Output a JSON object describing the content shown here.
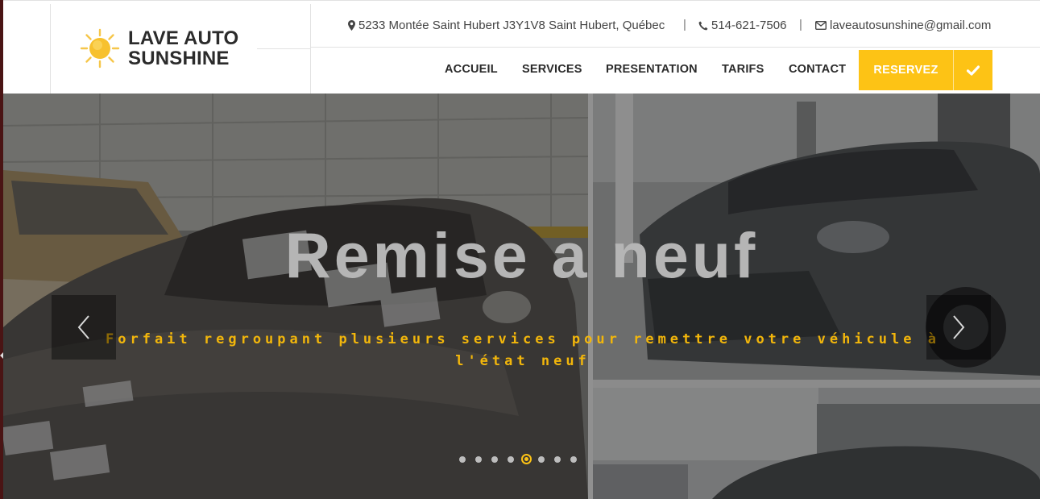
{
  "brand": {
    "name_line1": "LAVE AUTO",
    "name_line2": "SUNSHINE",
    "logo_icon": "sun-icon",
    "accent_color": "#fdc315"
  },
  "contact": {
    "address": "5233 Montée Saint Hubert J3Y1V8 Saint Hubert, Québec",
    "phone": "514-621-7506",
    "email": "laveautosunshine@gmail.com",
    "separator": "|"
  },
  "nav": {
    "items": [
      {
        "label": "ACCUEIL"
      },
      {
        "label": "SERVICES"
      },
      {
        "label": "PRESENTATION"
      },
      {
        "label": "TARIFS"
      },
      {
        "label": "CONTACT"
      }
    ],
    "reserve_label": "RESERVEZ",
    "check_icon": "check-icon"
  },
  "slider": {
    "title": "Remise a neuf",
    "subtitle": "Forfait regroupant plusieurs services pour remettre votre véhicule à l'état neuf",
    "prev_icon": "chevron-left-icon",
    "next_icon": "chevron-right-icon",
    "slide_count": 8,
    "active_slide": 5
  }
}
